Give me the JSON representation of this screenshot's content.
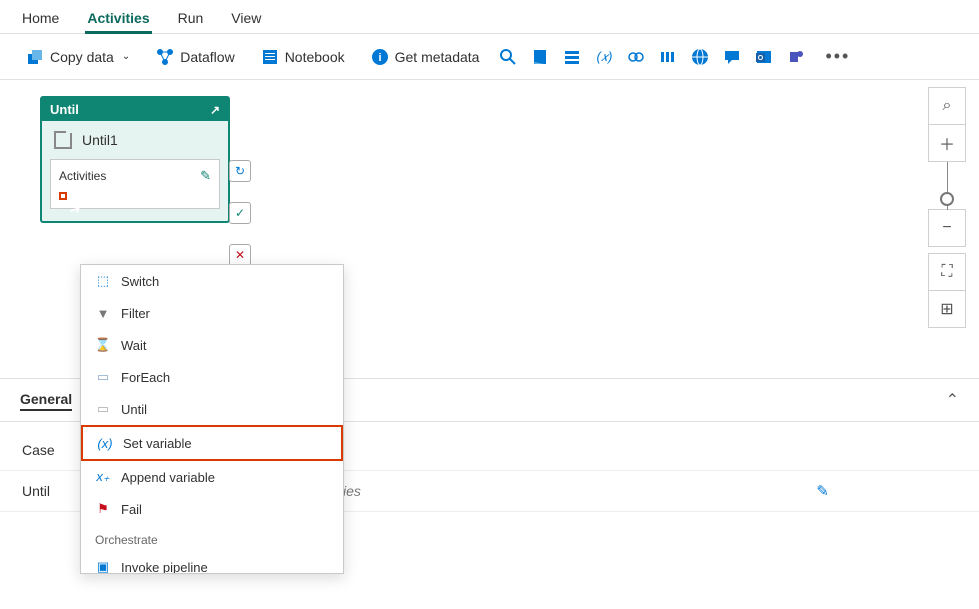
{
  "tabs": {
    "home": "Home",
    "activities": "Activities",
    "run": "Run",
    "view": "View"
  },
  "toolbar": {
    "copy_data": "Copy data",
    "dataflow": "Dataflow",
    "notebook": "Notebook",
    "get_metadata": "Get metadata"
  },
  "until_box": {
    "header": "Until",
    "name": "Until1",
    "activities_label": "Activities"
  },
  "connectors": {
    "retry": "↻",
    "success": "✓",
    "fail": "✕"
  },
  "context_menu": {
    "items": [
      {
        "icon": "⬚",
        "label": "Switch",
        "color": "#0078d4"
      },
      {
        "icon": "▼",
        "label": "Filter",
        "color": "#777"
      },
      {
        "icon": "⌛",
        "label": "Wait",
        "color": "#b07000"
      },
      {
        "icon": "▭",
        "label": "ForEach",
        "color": "#8ac"
      },
      {
        "icon": "▭",
        "label": "Until",
        "color": "#aaa"
      },
      {
        "icon": "(x)",
        "label": "Set variable",
        "color": "#0078d4",
        "hl": true
      },
      {
        "icon": "x₊",
        "label": "Append variable",
        "color": "#0078d4"
      },
      {
        "icon": "⚑",
        "label": "Fail",
        "color": "#c50f1f"
      }
    ],
    "section": "Orchestrate",
    "more": [
      {
        "icon": "▣",
        "label": "Invoke pipeline",
        "color": "#0078d4"
      }
    ]
  },
  "panel": {
    "tabs": {
      "general": "General"
    },
    "rows": {
      "case_label": "Case",
      "case_value": "",
      "until_label": "Until",
      "until_value": "tivities"
    }
  }
}
